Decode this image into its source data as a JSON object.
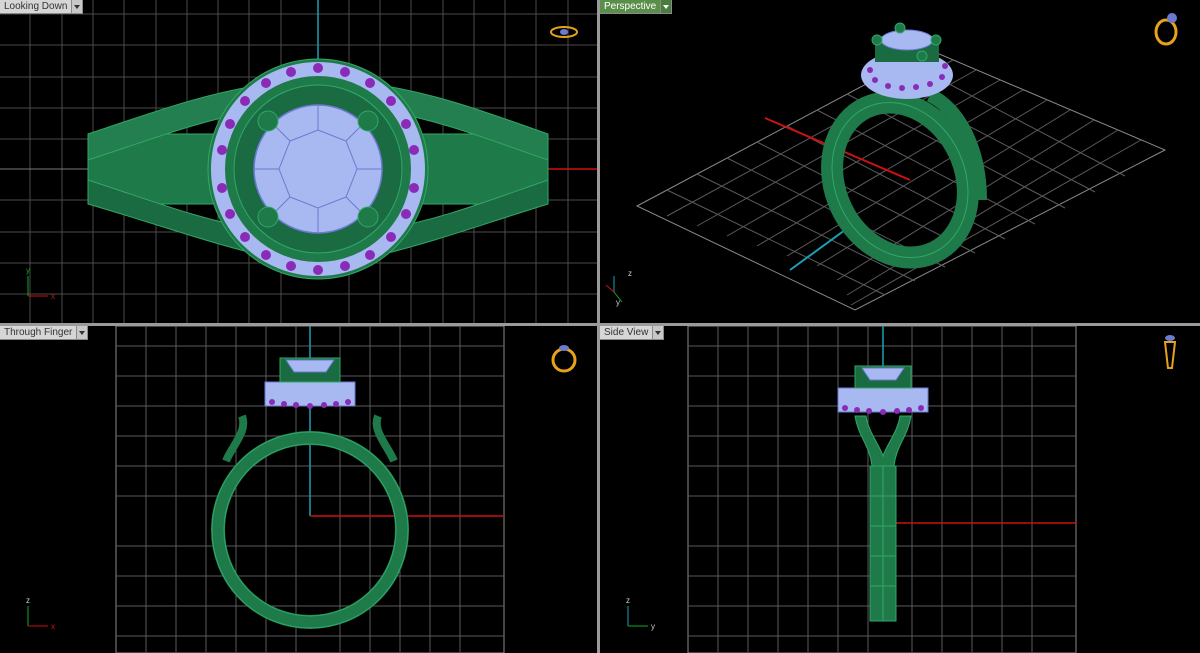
{
  "viewports": [
    {
      "id": "top",
      "label": "Looking Down",
      "active": false,
      "axes": [
        "y",
        "x"
      ],
      "view_icon": "ring-top-view-icon"
    },
    {
      "id": "persp",
      "label": "Perspective",
      "active": true,
      "axes": [
        "z",
        "y"
      ],
      "view_icon": "ring-perspective-view-icon"
    },
    {
      "id": "front",
      "label": "Through Finger",
      "active": false,
      "axes": [
        "z",
        "x"
      ],
      "view_icon": "ring-front-view-icon"
    },
    {
      "id": "side",
      "label": "Side View",
      "active": false,
      "axes": [
        "z",
        "y"
      ],
      "view_icon": "ring-side-view-icon"
    }
  ],
  "colors": {
    "background": "#000000",
    "grid": "#4a4a4a",
    "grid_major": "#7a7a7a",
    "metal": "#1f7a4a",
    "metal_light": "#2fa866",
    "stone": "#a8b8f0",
    "accent_stone": "#8a2bb8",
    "axis_x": "#cc1111",
    "axis_y": "#11aa22",
    "axis_z": "#1aa0b8",
    "icon_gold": "#e8a21a",
    "active_tab": "#5a8f4a"
  }
}
